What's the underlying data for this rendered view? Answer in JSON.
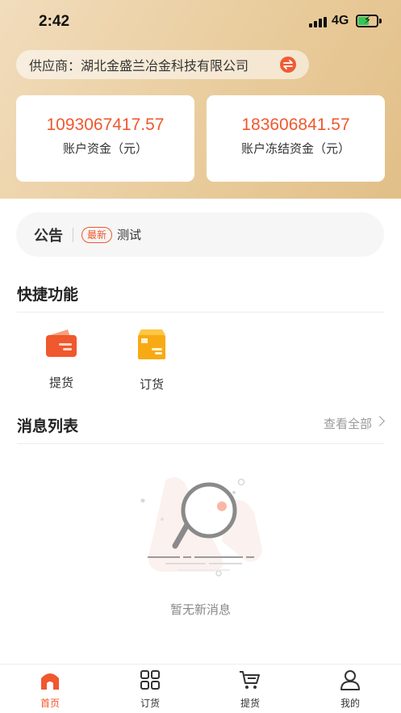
{
  "status_bar": {
    "time": "2:42",
    "network": "4G"
  },
  "header": {
    "supplier_label": "供应商：湖北金盛兰冶金科技有限公司",
    "accent_color": "#f0582e"
  },
  "balances": [
    {
      "amount": "1093067417.57",
      "label": "账户资金（元）"
    },
    {
      "amount": "183606841.57",
      "label": "账户冻结资金（元）"
    }
  ],
  "notice": {
    "title": "公告",
    "badge": "最新",
    "text": "测试"
  },
  "quick_functions": {
    "title": "快捷功能",
    "items": [
      {
        "label": "提货",
        "icon": "pickup-card-icon"
      },
      {
        "label": "订货",
        "icon": "order-box-icon"
      }
    ]
  },
  "messages": {
    "title": "消息列表",
    "view_all": "查看全部",
    "empty_text": "暂无新消息",
    "empty_icon": "magnifier-icon"
  },
  "tabbar": {
    "items": [
      {
        "label": "首页",
        "icon": "home-icon",
        "active": true
      },
      {
        "label": "订货",
        "icon": "grid-icon",
        "active": false
      },
      {
        "label": "提货",
        "icon": "cart-icon",
        "active": false
      },
      {
        "label": "我的",
        "icon": "user-icon",
        "active": false
      }
    ]
  }
}
